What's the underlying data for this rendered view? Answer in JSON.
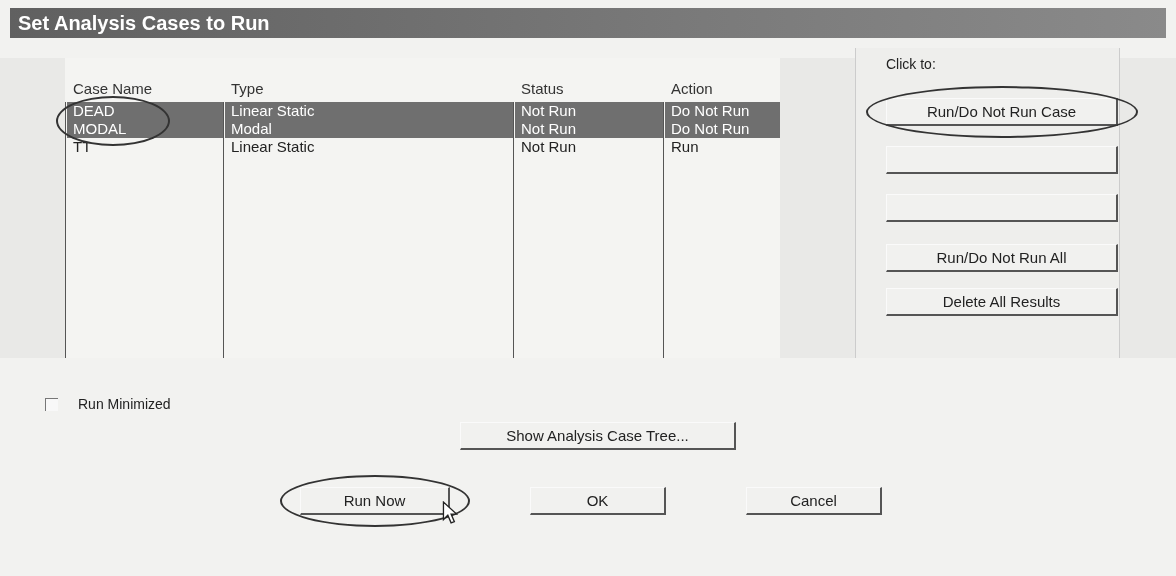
{
  "window": {
    "title": "Set Analysis Cases to Run"
  },
  "table": {
    "columns": [
      "Case Name",
      "Type",
      "Status",
      "Action"
    ],
    "circled": true,
    "rows": [
      {
        "case_name": "DEAD",
        "type": "Linear Static",
        "status": "Not Run",
        "action": "Do Not Run",
        "selected": true
      },
      {
        "case_name": "MODAL",
        "type": "Modal",
        "status": "Not Run",
        "action": "Do Not Run",
        "selected": true
      },
      {
        "case_name": "TT",
        "type": "Linear Static",
        "status": "Not Run",
        "action": "Run",
        "selected": false
      }
    ]
  },
  "side_panel": {
    "label": "Click to:",
    "buttons": [
      {
        "kind": "text",
        "label": "Run/Do Not Run Case",
        "circled": true
      },
      {
        "kind": "blank",
        "circled": false
      },
      {
        "kind": "blank",
        "circled": false
      },
      {
        "kind": "text",
        "label": "Run/Do Not Run All",
        "circled": false
      },
      {
        "kind": "text",
        "label": "Delete All Results",
        "circled": false
      }
    ]
  },
  "run_minimized": {
    "label": "Run Minimized",
    "checked": false
  },
  "tree_button": {
    "label": "Show Analysis Case Tree..."
  },
  "buttons": [
    {
      "label": "Run Now",
      "circled": true
    },
    {
      "label": "OK",
      "circled": false
    },
    {
      "label": "Cancel",
      "circled": false
    }
  ]
}
